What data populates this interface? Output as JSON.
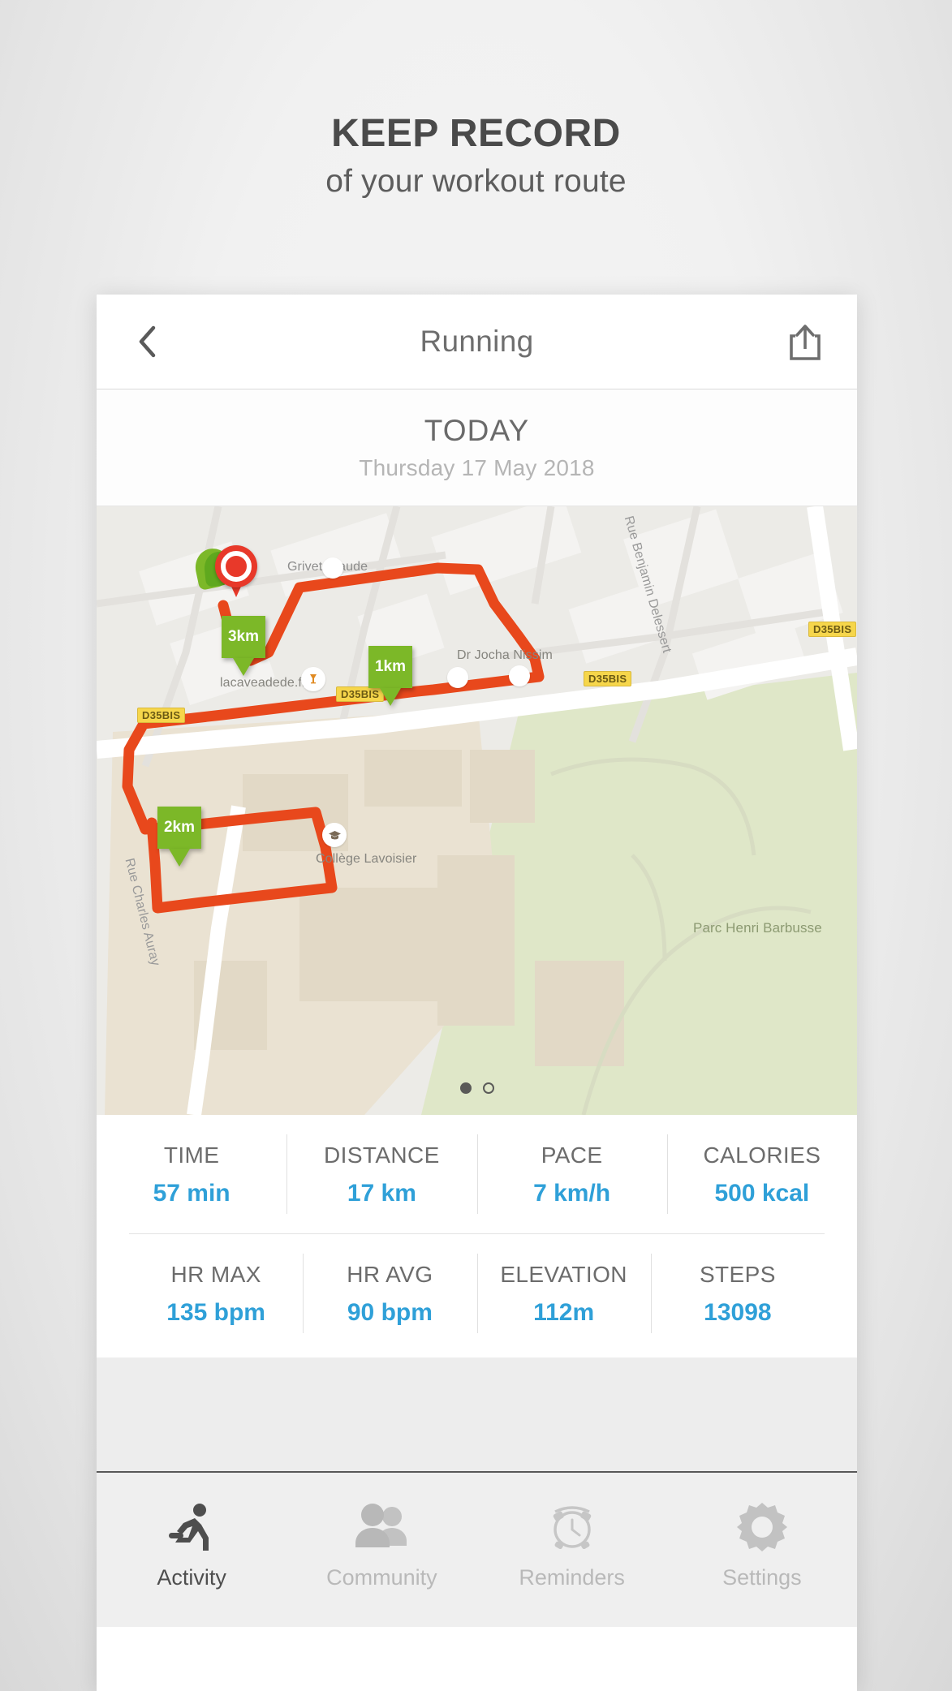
{
  "headline": {
    "title": "KEEP RECORD",
    "subtitle": "of your workout route"
  },
  "navbar": {
    "back_icon": "chevron-left-icon",
    "title": "Running",
    "share_icon": "share-upload-icon"
  },
  "datebar": {
    "today": "TODAY",
    "full_date": "Thursday 17 May 2018"
  },
  "map": {
    "route_color": "#e8481c",
    "marker_color": "#7cb828",
    "start_pin_color": "#e8392a",
    "km_markers": [
      {
        "label": "3km"
      },
      {
        "label": "1km"
      },
      {
        "label": "2km"
      }
    ],
    "labels": [
      {
        "text": "Grivet Claude"
      },
      {
        "text": "Dr Jocha Nissim"
      },
      {
        "text": "lacaveadede.fr"
      },
      {
        "text": "Collège Lavoisier"
      },
      {
        "text": "Rue Benjamin Delessert"
      },
      {
        "text": "Rue Charles Auray"
      },
      {
        "text": "Parc Henri Barbusse"
      }
    ],
    "road_shields": [
      "D35BIS",
      "D35BIS",
      "D35BIS",
      "D35BIS"
    ],
    "pagination": {
      "total": 2,
      "current": 1
    }
  },
  "stats": {
    "row1": [
      {
        "label": "TIME",
        "value": "57 min"
      },
      {
        "label": "DISTANCE",
        "value": "17 km"
      },
      {
        "label": "PACE",
        "value": "7 km/h"
      },
      {
        "label": "CALORIES",
        "value": "500 kcal"
      }
    ],
    "row2": [
      {
        "label": "HR MAX",
        "value": "135 bpm"
      },
      {
        "label": "HR AVG",
        "value": "90 bpm"
      },
      {
        "label": "ELEVATION",
        "value": "112m"
      },
      {
        "label": "STEPS",
        "value": "13098"
      }
    ],
    "value_color": "#2fa0d8"
  },
  "tabbar": {
    "tabs": [
      {
        "label": "Activity",
        "icon": "running-person-icon",
        "active": true
      },
      {
        "label": "Community",
        "icon": "people-group-icon",
        "active": false
      },
      {
        "label": "Reminders",
        "icon": "alarm-clock-icon",
        "active": false
      },
      {
        "label": "Settings",
        "icon": "gear-icon",
        "active": false
      }
    ]
  }
}
